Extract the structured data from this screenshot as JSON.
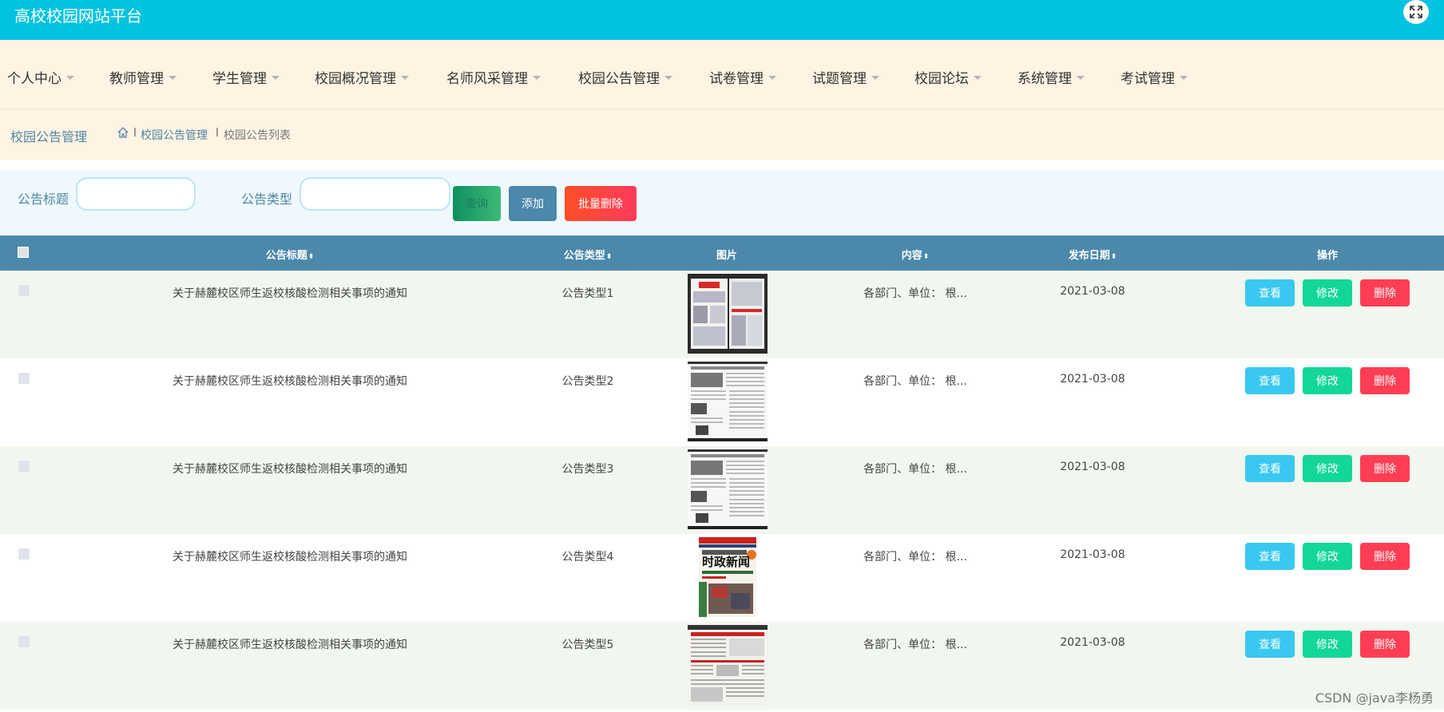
{
  "header": {
    "title": "高校校园网站平台"
  },
  "menu": [
    {
      "label": "个人中心"
    },
    {
      "label": "教师管理"
    },
    {
      "label": "学生管理"
    },
    {
      "label": "校园概况管理"
    },
    {
      "label": "名师风采管理"
    },
    {
      "label": "校园公告管理"
    },
    {
      "label": "试卷管理"
    },
    {
      "label": "试题管理"
    },
    {
      "label": "校园论坛"
    },
    {
      "label": "系统管理"
    },
    {
      "label": "考试管理"
    }
  ],
  "breadcrumb": {
    "page_title": "校园公告管理",
    "separator": "l",
    "items": [
      "校园公告管理",
      "校园公告列表"
    ]
  },
  "search": {
    "title_label": "公告标题",
    "title_value": "",
    "type_label": "公告类型",
    "type_value": "",
    "search_button": "查询",
    "add_button": "添加",
    "batch_delete_button": "批量删除"
  },
  "table": {
    "columns": [
      "公告标题",
      "公告类型",
      "图片",
      "内容",
      "发布日期",
      "操作"
    ],
    "sort_icon": "⬍",
    "rows": [
      {
        "title": "关于赫麓校区师生返校核酸检测相关事项的通知",
        "type": "公告类型1",
        "image": "newspaper-spread",
        "content": "各部门、单位： 根...",
        "date": "2021-03-08"
      },
      {
        "title": "关于赫麓校区师生返校核酸检测相关事项的通知",
        "type": "公告类型2",
        "image": "english-newspaper",
        "content": "各部门、单位： 根...",
        "date": "2021-03-08"
      },
      {
        "title": "关于赫麓校区师生返校核酸检测相关事项的通知",
        "type": "公告类型3",
        "image": "english-newspaper",
        "content": "各部门、单位： 根...",
        "date": "2021-03-08"
      },
      {
        "title": "关于赫麓校区师生返校核酸检测相关事项的通知",
        "type": "公告类型4",
        "image": "news-magazine-cover",
        "content": "各部门、单位： 根...",
        "date": "2021-03-08"
      },
      {
        "title": "关于赫麓校区师生返校核酸检测相关事项的通知",
        "type": "公告类型5",
        "image": "newspaper-page",
        "content": "各部门、单位： 根...",
        "date": "2021-03-08"
      }
    ],
    "row_actions": {
      "view": "查看",
      "edit": "修改",
      "delete": "删除"
    },
    "row_colors": [
      "#f1f7ee",
      "#ffffff"
    ]
  },
  "thumb4": {
    "headline": "时政新闻"
  },
  "watermark": "CSDN @java李杨勇",
  "colors": {
    "header": "#00c3e0",
    "menu_bg": "#fff3e3",
    "table_head": "#4b88aa",
    "view": "#39c8f0",
    "edit": "#13d69a",
    "delete": "#ff3e54"
  }
}
